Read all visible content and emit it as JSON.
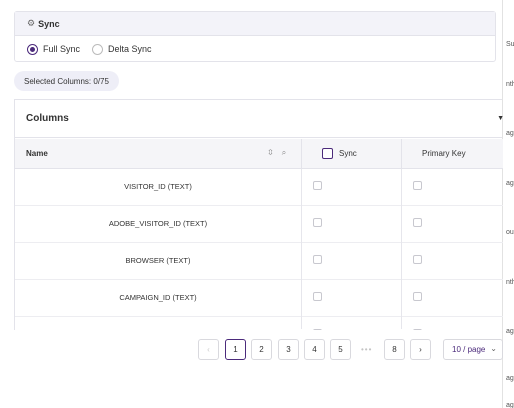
{
  "right_fragments": [
    "Su",
    "nth",
    "ag",
    "ag",
    "oun",
    "nth",
    "ag",
    "ag",
    "ag"
  ],
  "sync": {
    "title": "Sync",
    "icon": "gear-icon",
    "options": [
      {
        "label": "Full Sync",
        "checked": true
      },
      {
        "label": "Delta Sync",
        "checked": false
      }
    ]
  },
  "selected_columns": "Selected Columns: 0/75",
  "columns": {
    "title": "Columns",
    "headers": {
      "name": "Name",
      "sync": "Sync",
      "primary_key": "Primary Key"
    },
    "rows": [
      {
        "name": "VISITOR_ID (TEXT)"
      },
      {
        "name": "ADOBE_VISITOR_ID (TEXT)"
      },
      {
        "name": "BROWSER (TEXT)"
      },
      {
        "name": "CAMPAIGN_ID (TEXT)"
      }
    ]
  },
  "pagination": {
    "prev": "‹",
    "pages": [
      "1",
      "2",
      "3",
      "4",
      "5"
    ],
    "ellipsis": "•••",
    "last": "8",
    "next": "›",
    "current": "1",
    "page_size": "10 / page",
    "page_size_icon": "chevron-down-icon"
  },
  "accent_color": "#4b2a7b"
}
